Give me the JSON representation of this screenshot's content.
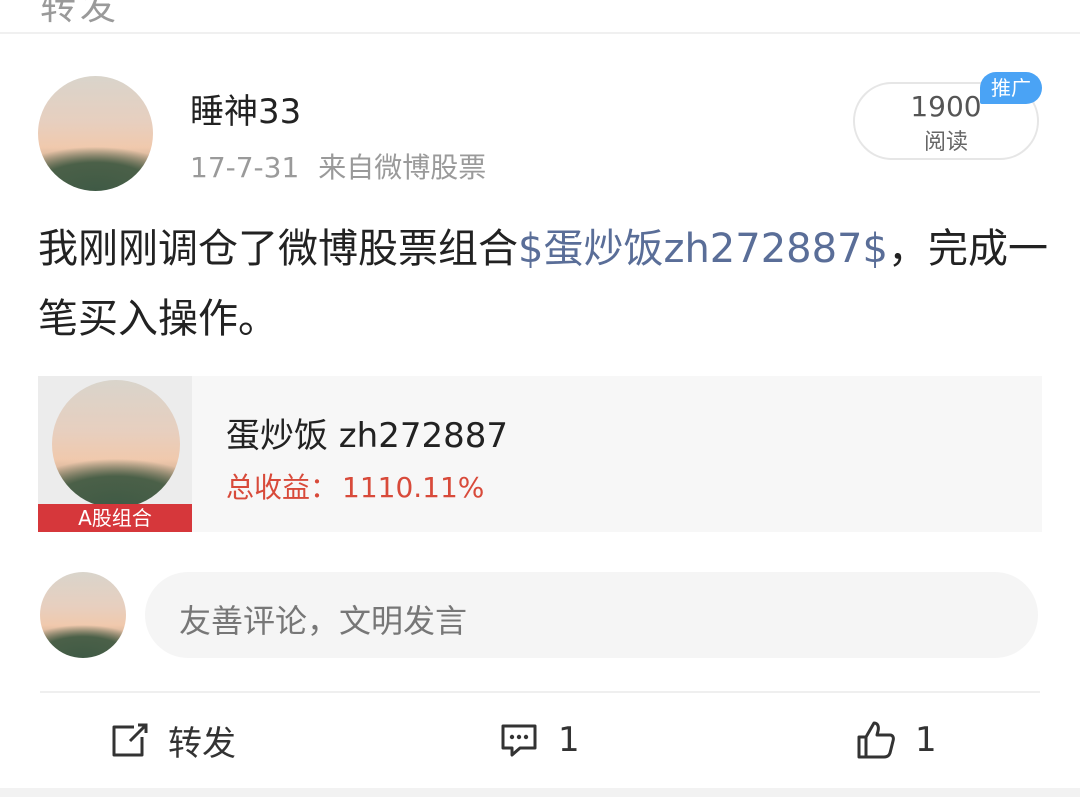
{
  "top": {
    "partial_text": "转发"
  },
  "post": {
    "username": "睡神33",
    "date": "17-7-31",
    "source": "来自微博股票",
    "read_count": "1900",
    "read_label": "阅读",
    "promo_badge": "推广",
    "text_before": "我刚刚调仓了微博股票组合",
    "text_link": "$蛋炒饭zh272887$",
    "text_after": "，完成一笔买入操作。"
  },
  "card": {
    "tag": "A股组合",
    "title": "蛋炒饭 zh272887",
    "gain_label": "总收益：",
    "gain_value": "1110.11%"
  },
  "comment": {
    "placeholder": "友善评论，文明发言"
  },
  "actions": {
    "repost_label": "转发",
    "comment_count": "1",
    "like_count": "1"
  },
  "icons": [
    "repost-icon",
    "comment-icon",
    "like-icon"
  ],
  "colors": {
    "link": "#5a6e98",
    "gain": "#d84a3a",
    "tag": "#d6373b",
    "badge": "#4aa3f5"
  }
}
